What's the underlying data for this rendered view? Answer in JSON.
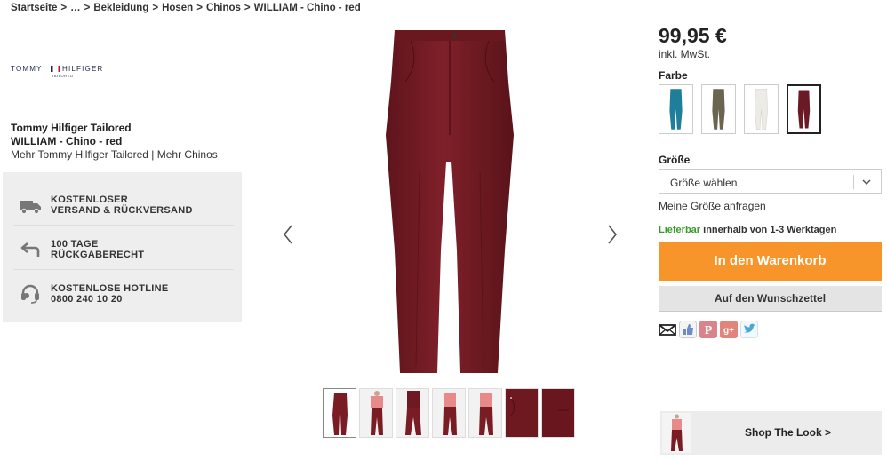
{
  "breadcrumb": {
    "items": [
      "Startseite",
      "…",
      "Bekleidung",
      "Hosen",
      "Chinos",
      "WILLIAM - Chino - red"
    ],
    "separator": ">"
  },
  "brand_logo": {
    "word_left": "TOMMY",
    "word_right": "HILFIGER",
    "sub": "TAILORED"
  },
  "product": {
    "brand": "Tommy Hilfiger Tailored",
    "name": "WILLIAM - Chino - red",
    "more_links": "Mehr Tommy Hilfiger Tailored | Mehr Chinos"
  },
  "perks": [
    {
      "icon": "truck-icon",
      "line1": "KOSTENLOSER",
      "line2": "VERSAND & RÜCKVERSAND"
    },
    {
      "icon": "return-arrow-icon",
      "line1": "100 TAGE",
      "line2": "RÜCKGABERECHT"
    },
    {
      "icon": "headset-icon",
      "line1": "KOSTENLOSE HOTLINE",
      "line2": "0800 240 10 20"
    }
  ],
  "gallery": {
    "main_color": "#7a1c24",
    "thumbnails": [
      "front",
      "model-front",
      "model-side",
      "model-back",
      "model-front-2",
      "detail-pocket",
      "detail-fabric"
    ]
  },
  "price": {
    "amount": "99,95 €",
    "vat": "inkl. MwSt."
  },
  "color": {
    "label": "Farbe",
    "swatches": [
      {
        "name": "petrol",
        "hex": "#1f7f9a",
        "selected": false
      },
      {
        "name": "olive",
        "hex": "#6b6550",
        "selected": false
      },
      {
        "name": "white",
        "hex": "#ecebe6",
        "selected": false
      },
      {
        "name": "red",
        "hex": "#6a1a25",
        "selected": true
      }
    ]
  },
  "size": {
    "label": "Größe",
    "placeholder": "Größe wählen",
    "request": "Meine Größe anfragen"
  },
  "delivery": {
    "status": "Lieferbar",
    "text": "innerhalb von 1-3 Werktagen"
  },
  "buttons": {
    "cart": "In den Warenkorb",
    "wishlist": "Auf den Wunschzettel",
    "shop_look": "Shop The Look >"
  },
  "share": [
    "mail-icon",
    "like-icon",
    "pinterest-icon",
    "google-plus-icon",
    "twitter-icon"
  ],
  "colors": {
    "accent_orange": "#f7952b",
    "available_green": "#3a9b2c",
    "panel_grey": "#eeeeee"
  }
}
